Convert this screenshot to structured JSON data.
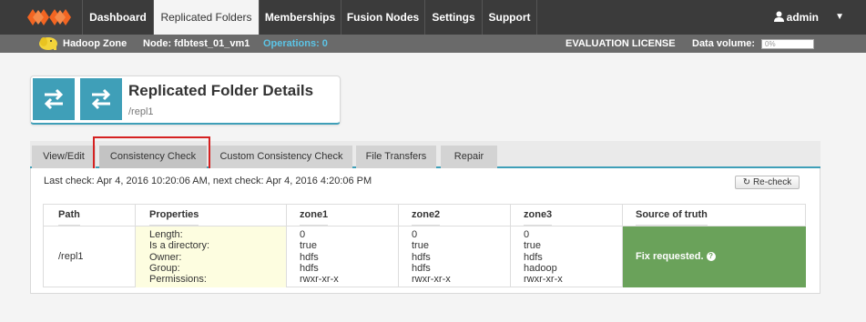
{
  "nav": {
    "tabs": [
      {
        "label": "Dashboard"
      },
      {
        "label": "Replicated Folders"
      },
      {
        "label": "Memberships"
      },
      {
        "label": "Fusion Nodes"
      },
      {
        "label": "Settings"
      },
      {
        "label": "Support"
      }
    ],
    "user": "admin"
  },
  "status": {
    "zone": "Hadoop Zone",
    "node": "Node: fdbtest_01_vm1",
    "operations": "Operations: 0",
    "license": "EVALUATION LICENSE",
    "volume_label": "Data volume:",
    "volume_value": "0%"
  },
  "header": {
    "title": "Replicated Folder Details",
    "path": "/repl1"
  },
  "tabs": [
    {
      "label": "View/Edit"
    },
    {
      "label": "Consistency Check"
    },
    {
      "label": "Custom Consistency Check"
    },
    {
      "label": "File Transfers"
    },
    {
      "label": "Repair"
    }
  ],
  "check": {
    "last_check": "Last check: Apr 4, 2016 10:20:06 AM, next check: Apr 4, 2016 4:20:06 PM",
    "recheck_label": "Re-check"
  },
  "table": {
    "headers": [
      "Path",
      "Properties",
      "zone1",
      "zone2",
      "zone3",
      "Source of truth"
    ],
    "path": "/repl1",
    "properties": "Length:\nIs a directory:\nOwner:\nGroup:\nPermissions:",
    "zone1": "0\ntrue\nhdfs\nhdfs\nrwxr-xr-x",
    "zone2": "0\ntrue\nhdfs\nhdfs\nrwxr-xr-x",
    "zone3": "0\ntrue\nhdfs\nhadoop\nrwxr-xr-x",
    "truth": "Fix requested."
  },
  "colors": {
    "accent": "#3f9fb8",
    "brand": "#f26522",
    "truth": "#6aa25a",
    "highlight": "#d52121"
  }
}
